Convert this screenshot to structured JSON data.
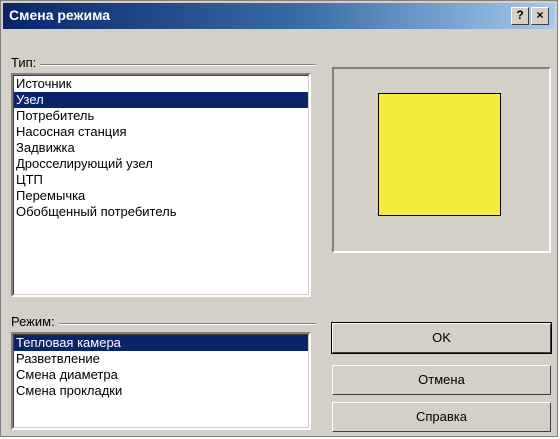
{
  "window": {
    "title": "Смена режима",
    "help_button": "?",
    "close_button": "×"
  },
  "type_group": {
    "label": "Тип:",
    "items": [
      "Источник",
      "Узел",
      "Потребитель",
      "Насосная станция",
      "Задвижка",
      "Дросселирующий узел",
      "ЦТП",
      "Перемычка",
      "Обобщенный потребитель"
    ],
    "selected": "Узел"
  },
  "preview": {
    "icon": "yellow-square",
    "color": "#f5ec3e"
  },
  "mode_group": {
    "label": "Режим:",
    "items": [
      "Тепловая камера",
      "Разветвление",
      "Смена диаметра",
      "Смена прокладки"
    ],
    "selected": "Тепловая камера"
  },
  "buttons": {
    "ok": "OK",
    "cancel": "Отмена",
    "help": "Справка"
  },
  "colors": {
    "selection": "#0a246a",
    "title_bar": "#0a246a",
    "dialog_bg": "#d4d0c8"
  }
}
